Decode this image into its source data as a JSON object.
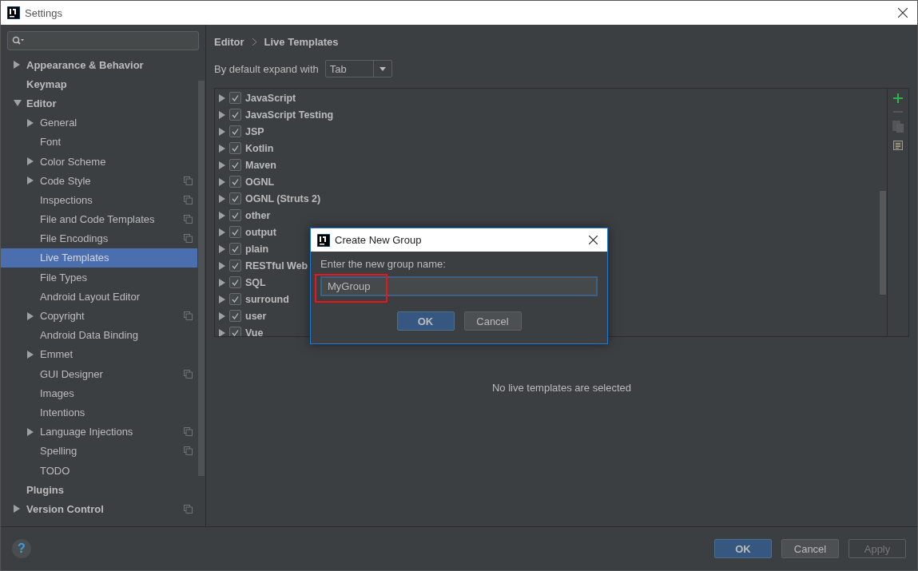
{
  "window": {
    "title": "Settings"
  },
  "sidebar": {
    "items": [
      {
        "label": "Appearance & Behavior",
        "expanded": false,
        "selected": false,
        "project_icon": false
      },
      {
        "label": "Keymap",
        "selected": false,
        "project_icon": false
      },
      {
        "label": "Editor",
        "expanded": true,
        "selected": false,
        "project_icon": false,
        "children": [
          {
            "label": "General",
            "expanded": false,
            "selected": false,
            "project_icon": false
          },
          {
            "label": "Font",
            "selected": false,
            "project_icon": false
          },
          {
            "label": "Color Scheme",
            "expanded": false,
            "selected": false,
            "project_icon": false
          },
          {
            "label": "Code Style",
            "expanded": false,
            "selected": false,
            "project_icon": true
          },
          {
            "label": "Inspections",
            "selected": false,
            "project_icon": true
          },
          {
            "label": "File and Code Templates",
            "selected": false,
            "project_icon": true
          },
          {
            "label": "File Encodings",
            "selected": false,
            "project_icon": true
          },
          {
            "label": "Live Templates",
            "selected": true,
            "project_icon": false
          },
          {
            "label": "File Types",
            "selected": false,
            "project_icon": false
          },
          {
            "label": "Android Layout Editor",
            "selected": false,
            "project_icon": false
          },
          {
            "label": "Copyright",
            "expanded": false,
            "selected": false,
            "project_icon": true
          },
          {
            "label": "Android Data Binding",
            "selected": false,
            "project_icon": false
          },
          {
            "label": "Emmet",
            "expanded": false,
            "selected": false,
            "project_icon": false
          },
          {
            "label": "GUI Designer",
            "selected": false,
            "project_icon": true
          },
          {
            "label": "Images",
            "selected": false,
            "project_icon": false
          },
          {
            "label": "Intentions",
            "selected": false,
            "project_icon": false
          },
          {
            "label": "Language Injections",
            "expanded": false,
            "selected": false,
            "project_icon": true
          },
          {
            "label": "Spelling",
            "selected": false,
            "project_icon": true
          },
          {
            "label": "TODO",
            "selected": false,
            "project_icon": false
          }
        ]
      },
      {
        "label": "Plugins",
        "selected": false,
        "project_icon": false
      },
      {
        "label": "Version Control",
        "expanded": false,
        "selected": false,
        "project_icon": true
      }
    ]
  },
  "breadcrumb": [
    "Editor",
    "Live Templates"
  ],
  "expand_with": {
    "label": "By default expand with",
    "value": "Tab"
  },
  "template_groups": [
    {
      "name": "JavaScript",
      "checked": true
    },
    {
      "name": "JavaScript Testing",
      "checked": true
    },
    {
      "name": "JSP",
      "checked": true
    },
    {
      "name": "Kotlin",
      "checked": true
    },
    {
      "name": "Maven",
      "checked": true
    },
    {
      "name": "OGNL",
      "checked": true
    },
    {
      "name": "OGNL (Struts 2)",
      "checked": true
    },
    {
      "name": "other",
      "checked": true
    },
    {
      "name": "output",
      "checked": true
    },
    {
      "name": "plain",
      "checked": true
    },
    {
      "name": "RESTful Web",
      "checked": true
    },
    {
      "name": "SQL",
      "checked": true
    },
    {
      "name": "surround",
      "checked": true
    },
    {
      "name": "user",
      "checked": true
    },
    {
      "name": "Vue",
      "checked": true
    }
  ],
  "empty_message": "No live templates are selected",
  "dialog": {
    "title": "Create New Group",
    "prompt": "Enter the new group name:",
    "value": "MyGroup",
    "buttons": [
      {
        "label": "OK",
        "kind": "primary"
      },
      {
        "label": "Cancel",
        "kind": "normal"
      }
    ]
  },
  "help": "?",
  "footer_buttons": [
    {
      "label": "OK",
      "kind": "primary"
    },
    {
      "label": "Cancel",
      "kind": "normal"
    },
    {
      "label": "Apply",
      "kind": "disabled"
    }
  ]
}
